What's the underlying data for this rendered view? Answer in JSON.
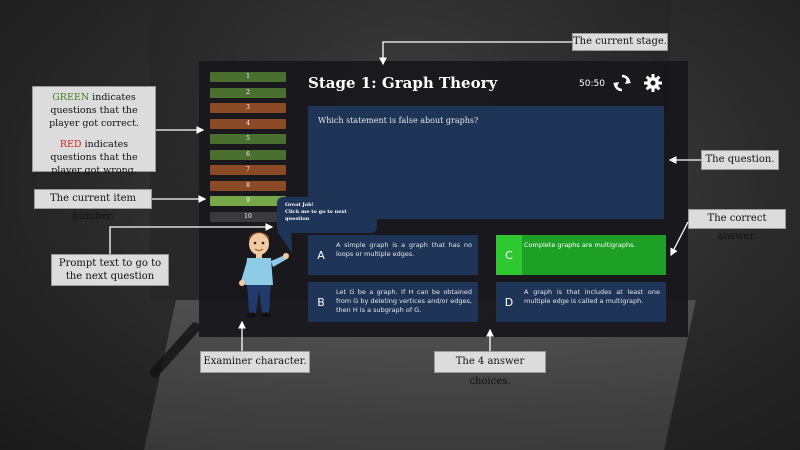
{
  "game": {
    "stage_title": "Stage 1: Graph Theory",
    "timer": "50:50",
    "question": "Which statement is false about graphs?",
    "items": [
      {
        "label": "1",
        "status": "green"
      },
      {
        "label": "2",
        "status": "green"
      },
      {
        "label": "3",
        "status": "red"
      },
      {
        "label": "4",
        "status": "red"
      },
      {
        "label": "5",
        "status": "green"
      },
      {
        "label": "6",
        "status": "green"
      },
      {
        "label": "7",
        "status": "red"
      },
      {
        "label": "8",
        "status": "red"
      },
      {
        "label": "9",
        "status": "current"
      },
      {
        "label": "10",
        "status": "pending"
      }
    ],
    "prompt": {
      "line1": "Great Job!",
      "line2": "Click me to go to next question"
    },
    "answers": [
      {
        "letter": "A",
        "text": "A simple graph is a graph that has no loops or multiple edges.",
        "correct": false
      },
      {
        "letter": "C",
        "text": "Complete graphs are multigraphs.",
        "correct": true
      },
      {
        "letter": "B",
        "text": "Let G be a graph. If H can be obtained from G by deleting vertices and/or edges, then H is a subgraph of G.",
        "correct": false
      },
      {
        "letter": "D",
        "text": "A graph is that includes at least one multiple edge is called a multigraph.",
        "correct": false
      }
    ]
  },
  "callouts": {
    "stage": "The current stage.",
    "question": "The question.",
    "correct_answer": "The correct answer.",
    "legend_green_word": "GREEN",
    "legend_green_rest": " indicates questions that the player got correct.",
    "legend_red_word": "RED",
    "legend_red_rest": " indicates questions that  the player got wrong.",
    "item_number": "The current item number.",
    "prompt_text": "Prompt text to go to the next question",
    "examiner": "Examiner character.",
    "answer_choices": "The 4 answer choices."
  },
  "colors": {
    "panel": "#18181c",
    "question_bg": "#1f3558",
    "correct": "#1ea026",
    "item_green": "#4b6f2e",
    "item_red": "#8a4a26",
    "item_current": "#76a84a"
  }
}
